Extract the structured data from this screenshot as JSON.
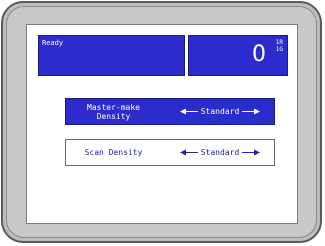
{
  "status": {
    "text": "Ready"
  },
  "counter": {
    "value": "0",
    "sub_line1": "1R",
    "sub_line2": "1G"
  },
  "settings": [
    {
      "label_line1": "Master-make",
      "label_line2": "Density",
      "value": "Standard",
      "selected": true
    },
    {
      "label_line1": "Scan Density",
      "label_line2": "",
      "value": "Standard",
      "selected": false
    }
  ],
  "colors": {
    "panel_blue": "#2c2ccc",
    "scan_text": "#2222aa",
    "bezel": "#bdbdbd"
  }
}
